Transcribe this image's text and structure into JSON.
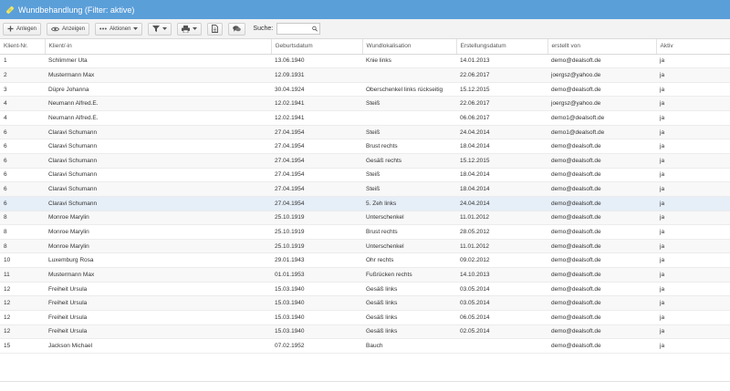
{
  "window": {
    "title": "Wundbehandlung (Filter: aktive)"
  },
  "colors": {
    "titlebar": "#5b9fd9",
    "selected_row": "#e6eef7"
  },
  "toolbar": {
    "create_label": "Anlegen",
    "show_label": "Anzeigen",
    "actions_label": "Aktionen",
    "search_label": "Suche:",
    "search_value": ""
  },
  "table": {
    "columns": [
      "Klient-Nr.",
      "Klient/-in",
      "Geburtsdatum",
      "Wundlokalisation",
      "Erstellungsdatum",
      "erstellt von",
      "Aktiv"
    ],
    "rows": [
      [
        "1",
        "Schlimmer Uta",
        "13.06.1940",
        "Knie links",
        "14.01.2013",
        "demo@dealsoft.de",
        "ja"
      ],
      [
        "2",
        "Mustermann Max",
        "12.09.1931",
        "",
        "22.06.2017",
        "joergsz@yahoo.de",
        "ja"
      ],
      [
        "3",
        "Düpre Johanna",
        "30.04.1924",
        "Oberschenkel links rückseitig",
        "15.12.2015",
        "demo@dealsoft.de",
        "ja"
      ],
      [
        "4",
        "Neumann Alfred.E.",
        "12.02.1941",
        "Steiß",
        "22.06.2017",
        "joergsz@yahoo.de",
        "ja"
      ],
      [
        "4",
        "Neumann Alfred.E.",
        "12.02.1941",
        "",
        "06.06.2017",
        "demo1@dealsoft.de",
        "ja"
      ],
      [
        "6",
        "Claravi Schumann",
        "27.04.1954",
        "Steiß",
        "24.04.2014",
        "demo1@dealsoft.de",
        "ja"
      ],
      [
        "6",
        "Claravi Schumann",
        "27.04.1954",
        "Brust rechts",
        "18.04.2014",
        "demo@dealsoft.de",
        "ja"
      ],
      [
        "6",
        "Claravi Schumann",
        "27.04.1954",
        "Gesäß rechts",
        "15.12.2015",
        "demo@dealsoft.de",
        "ja"
      ],
      [
        "6",
        "Claravi Schumann",
        "27.04.1954",
        "Steiß",
        "18.04.2014",
        "demo@dealsoft.de",
        "ja"
      ],
      [
        "6",
        "Claravi Schumann",
        "27.04.1954",
        "Steiß",
        "18.04.2014",
        "demo@dealsoft.de",
        "ja"
      ],
      [
        "6",
        "Claravi Schumann",
        "27.04.1954",
        "5. Zeh links",
        "24.04.2014",
        "demo@dealsoft.de",
        "ja"
      ],
      [
        "8",
        "Monroe Marylin",
        "25.10.1919",
        "Unterschenkel",
        "11.01.2012",
        "demo@dealsoft.de",
        "ja"
      ],
      [
        "8",
        "Monroe Marylin",
        "25.10.1919",
        "Brust rechts",
        "28.05.2012",
        "demo@dealsoft.de",
        "ja"
      ],
      [
        "8",
        "Monroe Marylin",
        "25.10.1919",
        "Unterschenkel",
        "11.01.2012",
        "demo@dealsoft.de",
        "ja"
      ],
      [
        "10",
        "Luxemburg Rosa",
        "29.01.1943",
        "Ohr rechts",
        "09.02.2012",
        "demo@dealsoft.de",
        "ja"
      ],
      [
        "11",
        "Mustermann Max",
        "01.01.1953",
        "Fußrücken rechts",
        "14.10.2013",
        "demo@dealsoft.de",
        "ja"
      ],
      [
        "12",
        "Freiheit Ursula",
        "15.03.1940",
        "Gesäß links",
        "03.05.2014",
        "demo@dealsoft.de",
        "ja"
      ],
      [
        "12",
        "Freiheit Ursula",
        "15.03.1940",
        "Gesäß links",
        "03.05.2014",
        "demo@dealsoft.de",
        "ja"
      ],
      [
        "12",
        "Freiheit Ursula",
        "15.03.1940",
        "Gesäß links",
        "06.05.2014",
        "demo@dealsoft.de",
        "ja"
      ],
      [
        "12",
        "Freiheit Ursula",
        "15.03.1940",
        "Gesäß links",
        "02.05.2014",
        "demo@dealsoft.de",
        "ja"
      ],
      [
        "15",
        "Jackson Michael",
        "07.02.1952",
        "Bauch",
        "",
        "demo@dealsoft.de",
        "ja"
      ]
    ],
    "selected_row": 10
  }
}
